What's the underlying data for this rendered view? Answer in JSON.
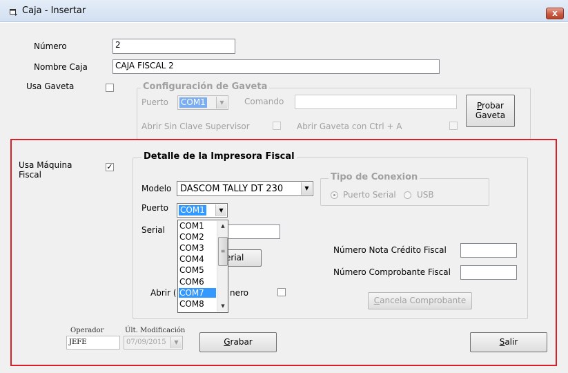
{
  "window": {
    "title": "Caja - Insertar",
    "close_glyph": "x"
  },
  "fields": {
    "numero_label": "Número",
    "numero_value": "2",
    "nombre_label": "Nombre Caja",
    "nombre_value": "CAJA FISCAL 2",
    "usa_gaveta_label": "Usa Gaveta"
  },
  "gaveta_group": {
    "title": "Configuración de Gaveta",
    "puerto_label": "Puerto",
    "puerto_value": "COM1",
    "comando_label": "Comando",
    "abrir_sin_clave_label": "Abrir Sin Clave Supervisor",
    "abrir_ctrl_label": "Abrir Gaveta con Ctrl + A",
    "probar_button": {
      "line1_first": "P",
      "line1_rest": "robar",
      "line2": "Gaveta"
    }
  },
  "fiscal": {
    "usa_maquina_label_line1": "Usa Máquina",
    "usa_maquina_label_line2": "Fiscal",
    "usa_maquina_check": "✓"
  },
  "impresora_group": {
    "title": "Detalle de la Impresora Fiscal",
    "modelo_label": "Modelo",
    "modelo_value": "DASCOM TALLY DT 230",
    "puerto_label": "Puerto",
    "puerto_value": "COM1",
    "serial_label": "Serial",
    "serial_button_text": "erial",
    "abrir_prefix": "Abrir (",
    "abrir_suffix": "nero",
    "nota_credito_label": "Número Nota Crédito Fiscal",
    "comprobante_label": "Número Comprobante Fiscal",
    "cancela_button": {
      "first": "C",
      "rest": "ancela Comprobante"
    }
  },
  "conexion_group": {
    "title": "Tipo de Conexion",
    "serial_option": "Puerto Serial",
    "usb_option": "USB"
  },
  "port_dropdown": {
    "items": [
      "COM1",
      "COM2",
      "COM3",
      "COM4",
      "COM5",
      "COM6",
      "COM7",
      "COM8"
    ],
    "selected_index": 6
  },
  "footer": {
    "operador_label": "Operador",
    "operador_value": "JEFE",
    "modificacion_label": "Últ. Modificación",
    "modificacion_value": "07/09/2015",
    "grabar": {
      "first": "G",
      "rest": "rabar"
    },
    "salir": {
      "first": "S",
      "rest": "alir"
    }
  },
  "colors": {
    "highlight_frame": "#d81f2a",
    "selection": "#3399ff"
  }
}
